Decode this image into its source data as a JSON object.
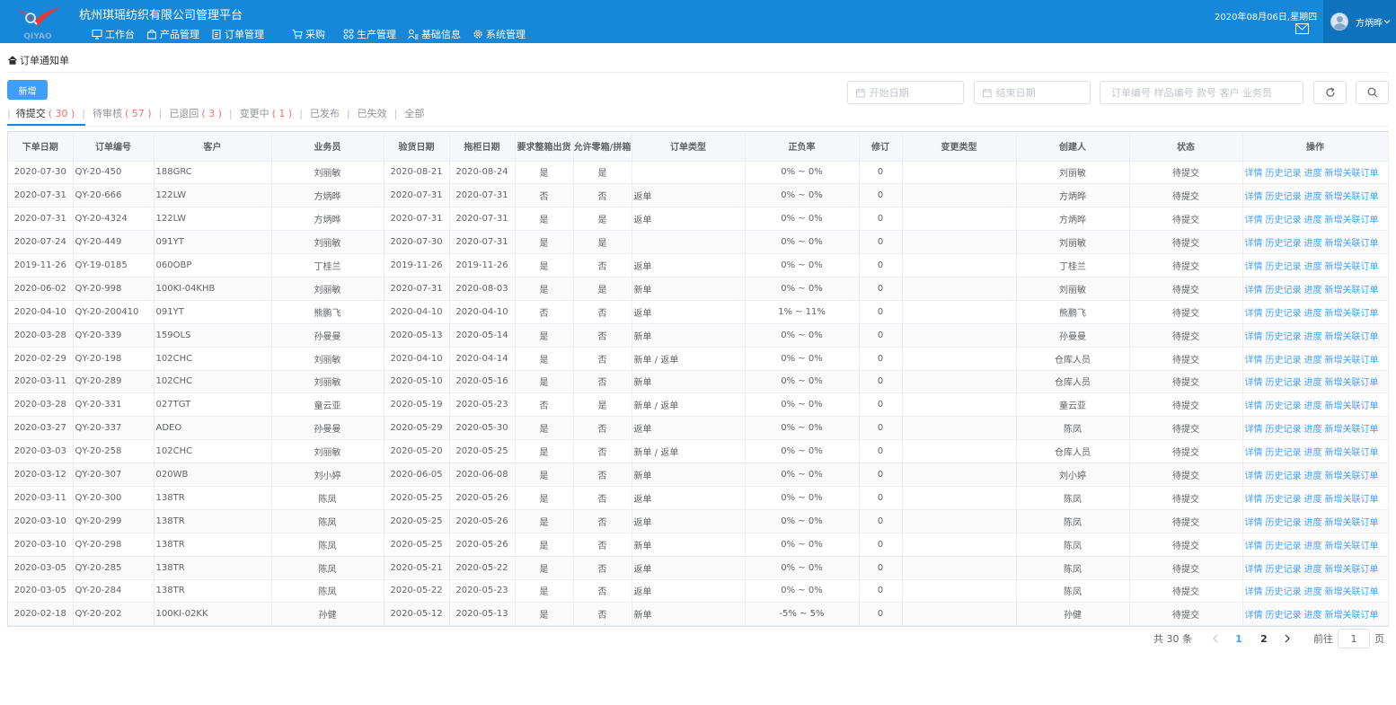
{
  "header": {
    "logo_text": "QIYAO",
    "title": "杭州琪瑶纺织有限公司管理平台",
    "nav": [
      {
        "label": "工作台",
        "icon": "monitor-icon"
      },
      {
        "label": "产品管理",
        "icon": "bag-icon"
      },
      {
        "label": "订单管理",
        "icon": "clipboard-icon"
      },
      {
        "label": "采购",
        "icon": "cart-icon"
      },
      {
        "label": "生产管理",
        "icon": "grid-icon"
      },
      {
        "label": "基础信息",
        "icon": "user-list-icon"
      },
      {
        "label": "系统管理",
        "icon": "gear-icon"
      }
    ],
    "date": "2020年08月06日,星期四",
    "user": "方炳晔"
  },
  "breadcrumb": "订单通知单",
  "toolbar": {
    "new_label": "新增",
    "start_date_placeholder": "开始日期",
    "end_date_placeholder": "结束日期",
    "search_placeholder": "订单编号 样品编号 款号 客户 业务员"
  },
  "tabs": [
    {
      "label": "待提交",
      "count": "( 30 )",
      "active": true
    },
    {
      "label": "待审核",
      "count": "( 57 )"
    },
    {
      "label": "已退回",
      "count": "( 3 )"
    },
    {
      "label": "变更中",
      "count": "( 1 )"
    },
    {
      "label": "已发布",
      "count": ""
    },
    {
      "label": "已失效",
      "count": ""
    },
    {
      "label": "全部",
      "count": ""
    }
  ],
  "table": {
    "columns": [
      "下单日期",
      "订单编号",
      "客户",
      "业务员",
      "验货日期",
      "拖柜日期",
      "要求整箱出货",
      "允许零箱/拼箱",
      "订单类型",
      "正负率",
      "修订",
      "变更类型",
      "创建人",
      "状态",
      "操作"
    ],
    "ops": [
      "详情",
      "历史记录",
      "进度",
      "新增关联订单"
    ],
    "rows": [
      [
        "2020-07-30",
        "QY-20-450",
        "188GRC",
        "刘丽敏",
        "2020-08-21",
        "2020-08-24",
        "是",
        "是",
        "",
        "0% ~ 0%",
        "0",
        "",
        "刘丽敏",
        "待提交"
      ],
      [
        "2020-07-31",
        "QY-20-666",
        "122LW",
        "方炳晔",
        "2020-07-31",
        "2020-07-31",
        "否",
        "否",
        "返单",
        "0% ~ 0%",
        "0",
        "",
        "方炳晔",
        "待提交"
      ],
      [
        "2020-07-31",
        "QY-20-4324",
        "122LW",
        "方炳晔",
        "2020-07-31",
        "2020-07-31",
        "是",
        "是",
        "返单",
        "0% ~ 0%",
        "0",
        "",
        "方炳晔",
        "待提交"
      ],
      [
        "2020-07-24",
        "QY-20-449",
        "091YT",
        "刘丽敏",
        "2020-07-30",
        "2020-07-31",
        "是",
        "是",
        "",
        "0% ~ 0%",
        "0",
        "",
        "刘丽敏",
        "待提交"
      ],
      [
        "2019-11-26",
        "QY-19-0185",
        "060OBP",
        "丁桂兰",
        "2019-11-26",
        "2019-11-26",
        "是",
        "否",
        "返单",
        "0% ~ 0%",
        "0",
        "",
        "丁桂兰",
        "待提交"
      ],
      [
        "2020-06-02",
        "QY-20-998",
        "100KI-04KHB",
        "刘丽敏",
        "2020-07-31",
        "2020-08-03",
        "是",
        "是",
        "新单",
        "0% ~ 0%",
        "0",
        "",
        "刘丽敏",
        "待提交"
      ],
      [
        "2020-04-10",
        "QY-20-200410",
        "091YT",
        "熊鹏飞",
        "2020-04-10",
        "2020-04-10",
        "否",
        "否",
        "返单",
        "1% ~ 11%",
        "0",
        "",
        "熊鹏飞",
        "待提交"
      ],
      [
        "2020-03-28",
        "QY-20-339",
        "159OLS",
        "孙曼曼",
        "2020-05-13",
        "2020-05-14",
        "是",
        "否",
        "新单",
        "0% ~ 0%",
        "0",
        "",
        "孙曼曼",
        "待提交"
      ],
      [
        "2020-02-29",
        "QY-20-198",
        "102CHC",
        "刘丽敏",
        "2020-04-10",
        "2020-04-14",
        "是",
        "否",
        "新单 / 返单",
        "0% ~ 0%",
        "0",
        "",
        "仓库人员",
        "待提交"
      ],
      [
        "2020-03-11",
        "QY-20-289",
        "102CHC",
        "刘丽敏",
        "2020-05-10",
        "2020-05-16",
        "是",
        "否",
        "新单",
        "0% ~ 0%",
        "0",
        "",
        "仓库人员",
        "待提交"
      ],
      [
        "2020-03-28",
        "QY-20-331",
        "027TGT",
        "童云亚",
        "2020-05-19",
        "2020-05-23",
        "否",
        "是",
        "新单 / 返单",
        "0% ~ 0%",
        "0",
        "",
        "童云亚",
        "待提交"
      ],
      [
        "2020-03-27",
        "QY-20-337",
        "ADEO",
        "孙曼曼",
        "2020-05-29",
        "2020-05-30",
        "是",
        "否",
        "返单",
        "0% ~ 0%",
        "0",
        "",
        "陈凤",
        "待提交"
      ],
      [
        "2020-03-03",
        "QY-20-258",
        "102CHC",
        "刘丽敏",
        "2020-05-20",
        "2020-05-25",
        "是",
        "否",
        "新单 / 返单",
        "0% ~ 0%",
        "0",
        "",
        "仓库人员",
        "待提交"
      ],
      [
        "2020-03-12",
        "QY-20-307",
        "020WB",
        "刘小婷",
        "2020-06-05",
        "2020-06-08",
        "是",
        "否",
        "新单",
        "0% ~ 0%",
        "0",
        "",
        "刘小婷",
        "待提交"
      ],
      [
        "2020-03-11",
        "QY-20-300",
        "138TR",
        "陈凤",
        "2020-05-25",
        "2020-05-26",
        "是",
        "否",
        "返单",
        "0% ~ 0%",
        "0",
        "",
        "陈凤",
        "待提交"
      ],
      [
        "2020-03-10",
        "QY-20-299",
        "138TR",
        "陈凤",
        "2020-05-25",
        "2020-05-26",
        "是",
        "否",
        "返单",
        "0% ~ 0%",
        "0",
        "",
        "陈凤",
        "待提交"
      ],
      [
        "2020-03-10",
        "QY-20-298",
        "138TR",
        "陈凤",
        "2020-05-25",
        "2020-05-26",
        "是",
        "否",
        "新单",
        "0% ~ 0%",
        "0",
        "",
        "陈凤",
        "待提交"
      ],
      [
        "2020-03-05",
        "QY-20-285",
        "138TR",
        "陈凤",
        "2020-05-21",
        "2020-05-22",
        "是",
        "否",
        "返单",
        "0% ~ 0%",
        "0",
        "",
        "陈凤",
        "待提交"
      ],
      [
        "2020-03-05",
        "QY-20-284",
        "138TR",
        "陈凤",
        "2020-05-22",
        "2020-05-23",
        "是",
        "否",
        "返单",
        "0% ~ 0%",
        "0",
        "",
        "陈凤",
        "待提交"
      ],
      [
        "2020-02-18",
        "QY-20-202",
        "100KI-02KK",
        "孙健",
        "2020-05-12",
        "2020-05-13",
        "是",
        "否",
        "新单",
        "-5% ~ 5%",
        "0",
        "",
        "孙健",
        "待提交"
      ]
    ]
  },
  "pagination": {
    "total": "共 30 条",
    "pages": [
      "1",
      "2"
    ],
    "current": "1",
    "goto_label": "前往",
    "goto_value": "1",
    "page_suffix": "页"
  },
  "colors": {
    "header_bg": "#1687d9",
    "primary": "#409eff",
    "count_red": "#f56c6c"
  }
}
